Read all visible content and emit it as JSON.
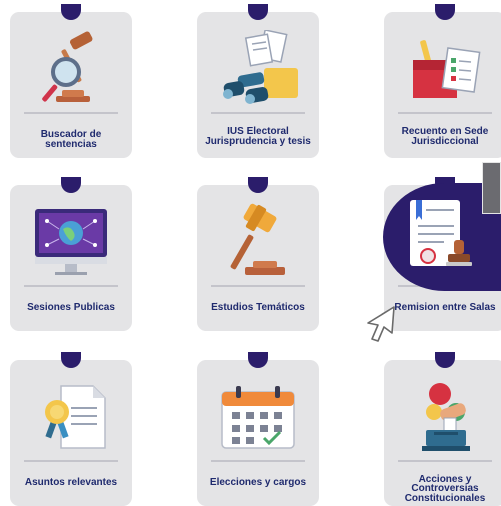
{
  "cards": [
    {
      "label": "Buscador de sentencias",
      "icon": "magnifier-gavel-icon"
    },
    {
      "label_line1": "IUS Electoral",
      "label_line2": "Jurisprudencia y tesis",
      "icon": "binoculars-documents-icon"
    },
    {
      "label_line1": "Recuento en Sede",
      "label_line2": "Jurisdiccional",
      "icon": "ballot-box-icon"
    },
    {
      "label": "Sesiones Publicas",
      "icon": "monitor-globe-icon"
    },
    {
      "label": "Estudios Temáticos",
      "icon": "gavel-icon"
    },
    {
      "label": "Remision entre Salas",
      "icon": "document-stamp-icon"
    },
    {
      "label": "Asuntos relevantes",
      "icon": "certificate-ribbon-icon"
    },
    {
      "label": "Elecciones y cargos",
      "icon": "calendar-icon"
    },
    {
      "label_line1": "Acciones y",
      "label_line2": "Controversias",
      "label_line3": "Constitucionales",
      "icon": "voting-hand-icon"
    }
  ],
  "colors": {
    "card_bg": "#e4e4e6",
    "accent_navy": "#2b1d6b",
    "label_text": "#1f2a6e"
  }
}
